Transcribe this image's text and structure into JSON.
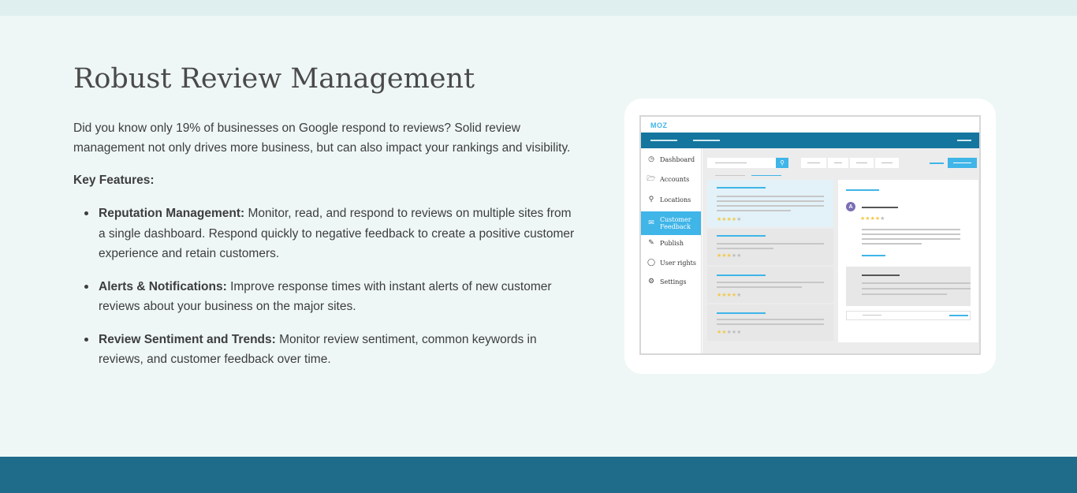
{
  "section": {
    "title": "Robust Review Management",
    "intro": "Did you know only 19% of businesses on Google respond to reviews? Solid review management not only drives more business, but can also impact your rankings and visibility.",
    "key_features_label": "Key Features:",
    "features": [
      {
        "title": "Reputation Management:",
        "text": " Monitor, read, and respond to reviews on multiple sites from a single dashboard. Respond quickly to negative feedback to create a positive customer experience and retain customers."
      },
      {
        "title": "Alerts & Notifications:",
        "text": " Improve response times with instant alerts of new customer reviews about your business on the major sites."
      },
      {
        "title": "Review Sentiment and Trends:",
        "text": " Monitor review sentiment, common keywords in reviews, and customer feedback over time."
      }
    ]
  },
  "mockup": {
    "logo": "MOZ",
    "sidebar": [
      {
        "label": "Dashboard",
        "icon": "dashboard-icon"
      },
      {
        "label": "Accounts",
        "icon": "folder-icon"
      },
      {
        "label": "Locations",
        "icon": "location-icon"
      },
      {
        "label": "Customer Feedback",
        "icon": "feedback-icon",
        "active": true
      },
      {
        "label": "Publish",
        "icon": "publish-icon"
      },
      {
        "label": "User rights",
        "icon": "user-icon"
      },
      {
        "label": "Settings",
        "icon": "gear-icon"
      }
    ],
    "avatar_letter": "A",
    "review_ratings": [
      4,
      3,
      4,
      2
    ],
    "detail_rating": 4,
    "colors": {
      "topbar": "#14769f",
      "accent": "#3fb5e8",
      "footer": "#1f6b8a",
      "background": "#eef7f6",
      "star": "#f2c94c"
    }
  }
}
